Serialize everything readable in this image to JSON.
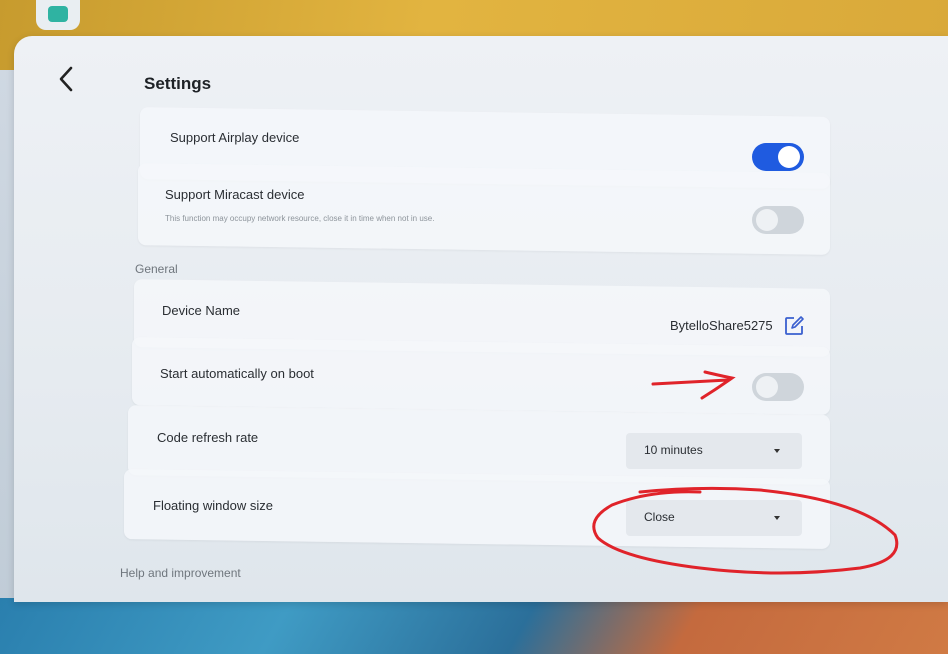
{
  "header": {
    "title": "Settings"
  },
  "rows": {
    "airplay": {
      "label": "Support Airplay device",
      "enabled": true
    },
    "miracast": {
      "label": "Support Miracast device",
      "description": "This function may occupy network resource, close it in time when not in use.",
      "enabled": false
    },
    "device_name": {
      "label": "Device Name",
      "value": "BytelloShare5275"
    },
    "autostart": {
      "label": "Start automatically on boot",
      "enabled": false
    },
    "refresh_rate": {
      "label": "Code refresh rate",
      "value": "10 minutes"
    },
    "floating_window": {
      "label": "Floating window size",
      "value": "Close"
    }
  },
  "sections": {
    "general": "General",
    "help": "Help and improvement"
  },
  "icons": {
    "back": "back-chevron-icon",
    "edit": "edit-icon",
    "dropdown": "chevron-down-icon"
  },
  "colors": {
    "toggle_on": "#1f5be0",
    "toggle_off": "#cfd5db",
    "annotation_red": "#e0232a"
  }
}
